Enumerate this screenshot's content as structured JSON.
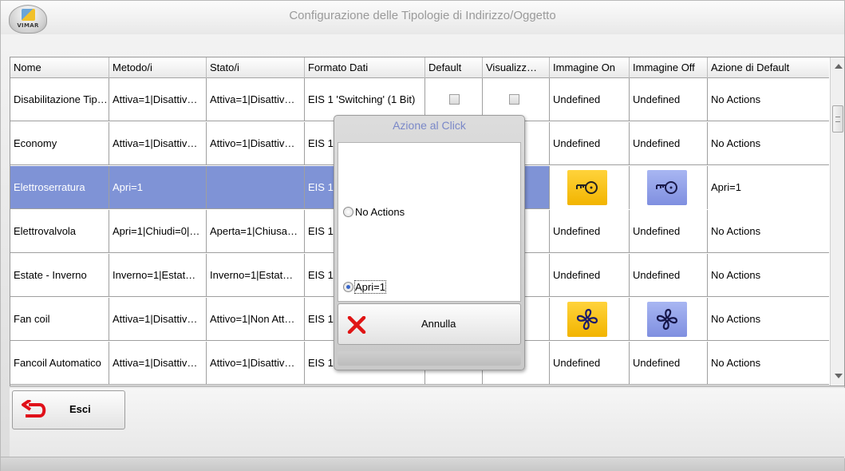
{
  "window": {
    "title": "Configurazione delle Tipologie di Indirizzo/Oggetto",
    "logo_text": "VIMAR"
  },
  "colors": {
    "selection": "#7f93d6",
    "image_on": "#f2b400",
    "image_off": "#8896e6",
    "dialog_title": "#7a88c8"
  },
  "table": {
    "columns": [
      "Nome",
      "Metodo/i",
      "Stato/i",
      "Formato Dati",
      "Default",
      "Visualizz…",
      "Immagine On",
      "Immagine Off",
      "Azione di Default"
    ],
    "rows": [
      {
        "nome": "Disabilitazione Tip…",
        "metodo": "Attiva=1|Disattiv…",
        "stato": "Attiva=1|Disattiv…",
        "formato": "EIS 1 'Switching' (1 Bit)",
        "default": false,
        "visualizza": false,
        "img_on": "Undefined",
        "img_off": "Undefined",
        "azione": "No Actions"
      },
      {
        "nome": "Economy",
        "metodo": "Attiva=1|Disattiv…",
        "stato": "Attivo=1|Disattiv…",
        "formato": "EIS 1",
        "img_on": "Undefined",
        "img_off": "Undefined",
        "azione": "No Actions"
      },
      {
        "nome": "Elettroserratura",
        "metodo": "Apri=1",
        "stato": "",
        "formato": "EIS 1",
        "img_on_icon": "key-lock-icon",
        "img_off_icon": "key-lock-icon",
        "azione": "Apri=1",
        "selected": true
      },
      {
        "nome": "Elettrovalvola",
        "metodo": "Apri=1|Chiudi=0|…",
        "stato": "Aperta=1|Chiusa…",
        "formato": "EIS 1",
        "img_on": "Undefined",
        "img_off": "Undefined",
        "azione": "No Actions"
      },
      {
        "nome": "Estate - Inverno",
        "metodo": "Inverno=1|Estat…",
        "stato": "Inverno=1|Estat…",
        "formato": "EIS 1",
        "img_on": "Undefined",
        "img_off": "Undefined",
        "azione": "No Actions"
      },
      {
        "nome": "Fan coil",
        "metodo": "Attiva=1|Disattiv…",
        "stato": "Attivo=1|Non Att…",
        "formato": "EIS 1",
        "img_on_icon": "fan-icon",
        "img_off_icon": "fan-icon",
        "azione": "No Actions"
      },
      {
        "nome": "Fancoil Automatico",
        "metodo": "Attiva=1|Disattiv…",
        "stato": "Attivo=1|Disattiv…",
        "formato": "EIS 1",
        "img_on": "Undefined",
        "img_off": "Undefined",
        "azione": "No Actions"
      }
    ]
  },
  "footer": {
    "exit_label": "Esci"
  },
  "dialog": {
    "title": "Azione al Click",
    "options": [
      {
        "label": "No Actions",
        "checked": false
      },
      {
        "label": "Apri=1",
        "checked": true
      }
    ],
    "cancel_label": "Annulla"
  }
}
